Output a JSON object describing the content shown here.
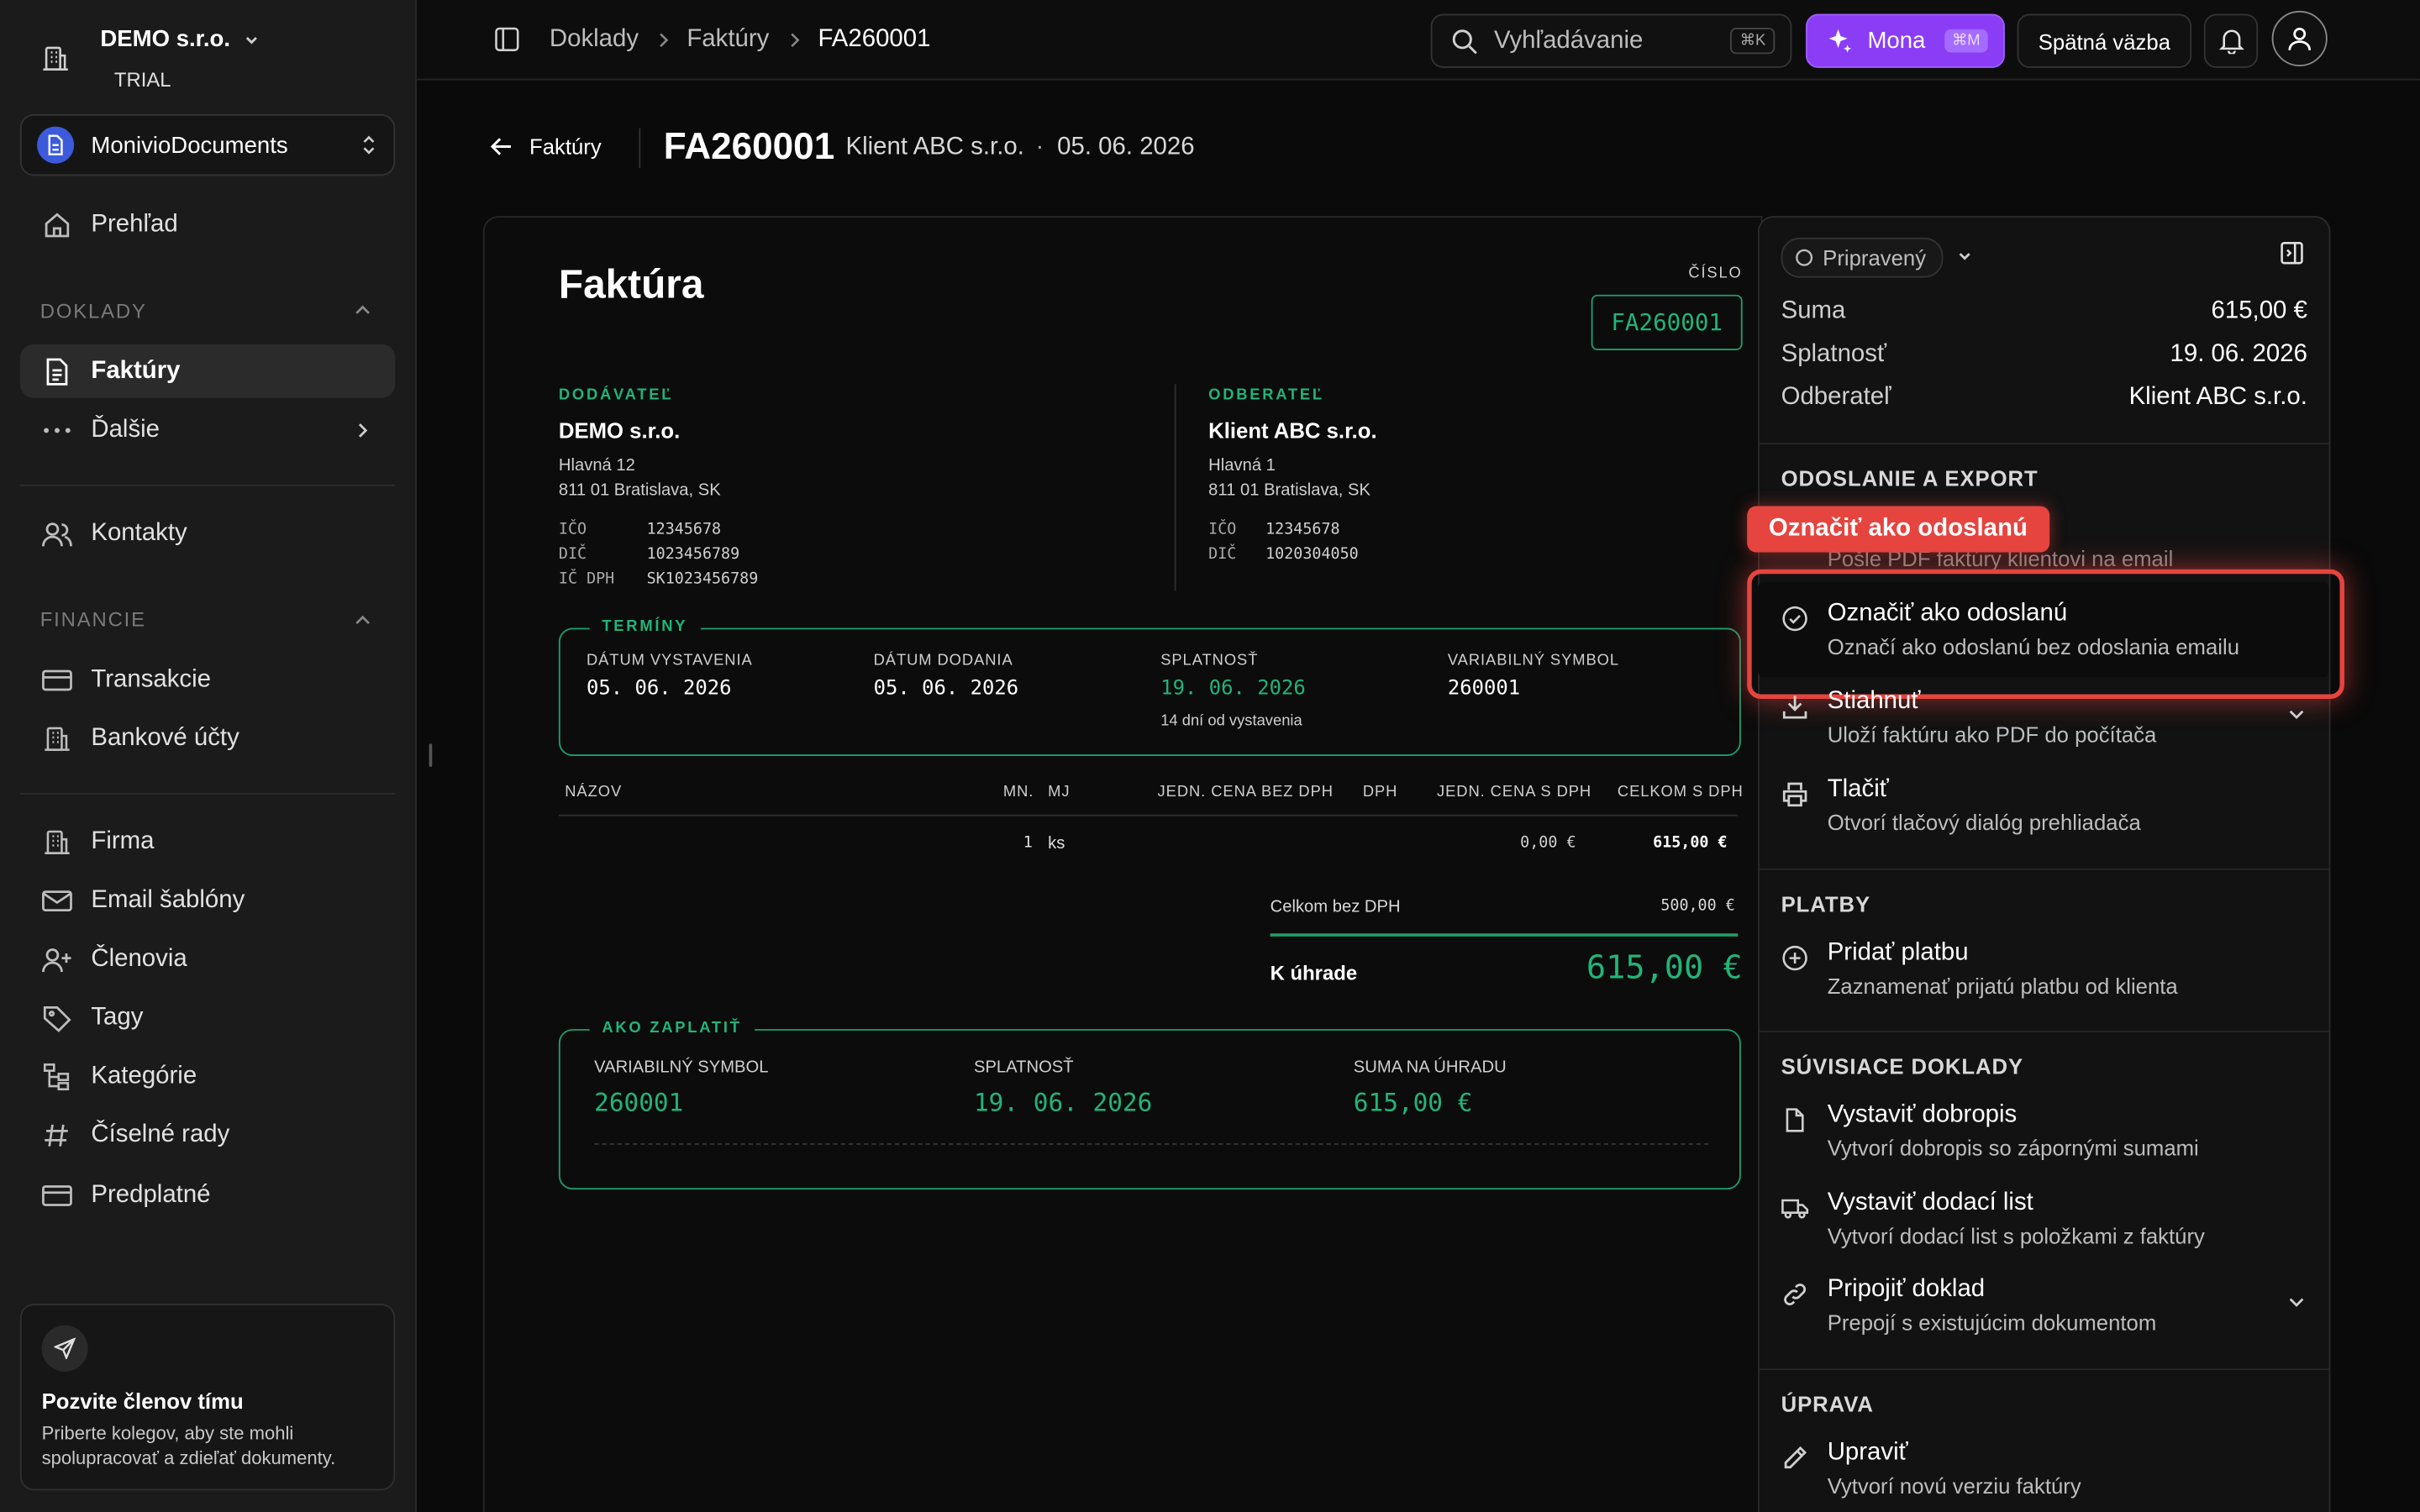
{
  "sidebar": {
    "org_name": "DEMO s.r.o.",
    "org_plan": "TRIAL",
    "workspace": "MonivioDocuments",
    "overview": "Prehľad",
    "section_docs": "DOKLADY",
    "invoices": "Faktúry",
    "more": "Ďalšie",
    "contacts": "Kontakty",
    "section_finance": "FINANCIE",
    "transactions": "Transakcie",
    "bank_accounts": "Bankové účty",
    "company": "Firma",
    "email_templates": "Email šablóny",
    "members": "Členovia",
    "tags": "Tagy",
    "categories": "Kategórie",
    "number_series": "Číselné rady",
    "subscription": "Predplatné",
    "invite_title": "Pozvite členov tímu",
    "invite_text": "Priberte kolegov, aby ste mohli spolupracovať a zdieľať dokumenty."
  },
  "topbar": {
    "crumb1": "Doklady",
    "crumb2": "Faktúry",
    "crumb3": "FA260001",
    "search_placeholder": "Vyhľadávanie",
    "search_shortcut": "⌘K",
    "mona": "Mona",
    "mona_shortcut": "⌘M",
    "feedback": "Spätná väzba"
  },
  "header": {
    "back": "Faktúry",
    "number": "FA260001",
    "client": "Klient ABC s.r.o.",
    "dot": "·",
    "date": "05. 06. 2026"
  },
  "invoice": {
    "title": "Faktúra",
    "number_label": "ČÍSLO",
    "number": "FA260001",
    "supplier_label": "DODÁVATEĽ",
    "supplier_name": "DEMO s.r.o.",
    "supplier_addr1": "Hlavná 12",
    "supplier_addr2": "811 01 Bratislava, SK",
    "supplier_ico_k": "IČO",
    "supplier_ico_v": "12345678",
    "supplier_dic_k": "DIČ",
    "supplier_dic_v": "1023456789",
    "supplier_icdph_k": "IČ DPH",
    "supplier_icdph_v": "SK1023456789",
    "customer_label": "ODBERATEĽ",
    "customer_name": "Klient ABC s.r.o.",
    "customer_addr1": "Hlavná 1",
    "customer_addr2": "811 01 Bratislava, SK",
    "customer_ico_k": "IČO",
    "customer_ico_v": "12345678",
    "customer_dic_k": "DIČ",
    "customer_dic_v": "1020304050",
    "terms_label": "TERMÍNY",
    "issue_label": "DÁTUM VYSTAVENIA",
    "issue_date": "05. 06. 2026",
    "delivery_label": "DÁTUM DODANIA",
    "delivery_date": "05. 06. 2026",
    "due_label": "SPLATNOSŤ",
    "due_date": "19. 06. 2026",
    "due_note": "14 dní od vystavenia",
    "vs_label": "VARIABILNÝ SYMBOL",
    "vs": "260001",
    "col_name": "NÁZOV",
    "col_qty": "MN.",
    "col_unit": "MJ",
    "col_price": "JEDN. CENA BEZ DPH",
    "col_vat": "DPH",
    "col_price_vat": "JEDN. CENA S DPH",
    "col_total": "CELKOM S DPH",
    "row_qty": "1",
    "row_unit": "ks",
    "row_price_vat": "0,00 €",
    "row_total": "615,00 €",
    "subtotal_label": "Celkom bez DPH",
    "subtotal": "500,00 €",
    "to_pay_label": "K úhrade",
    "to_pay": "615,00 €",
    "pay_label": "AKO ZAPLATIŤ",
    "pay_vs_label": "VARIABILNÝ SYMBOL",
    "pay_vs": "260001",
    "pay_due_label": "SPLATNOSŤ",
    "pay_due": "19. 06. 2026",
    "pay_amount_label": "SUMA NA ÚHRADU",
    "pay_amount": "615,00 €"
  },
  "panel": {
    "status": "Pripravený",
    "sum_k": "Suma",
    "sum_v": "615,00 €",
    "due_k": "Splatnosť",
    "due_v": "19. 06. 2026",
    "cust_k": "Odberateľ",
    "cust_v": "Klient ABC s.r.o.",
    "sec_send": "ODOSLANIE A EXPORT",
    "send_sub": "Pošle PDF faktúry klientovi na email",
    "tooltip": "Označiť ako odoslanú",
    "mark_title": "Označiť ako odoslanú",
    "mark_sub": "Označí ako odoslanú bez odoslania emailu",
    "download_title": "Stiahnuť",
    "download_sub": "Uloží faktúru ako PDF do počítača",
    "print_title": "Tlačiť",
    "print_sub": "Otvorí tlačový dialóg prehliadača",
    "sec_payments": "PLATBY",
    "addpay_title": "Pridať platbu",
    "addpay_sub": "Zaznamenať prijatú platbu od klienta",
    "sec_related": "SÚVISIACE DOKLADY",
    "credit_title": "Vystaviť dobropis",
    "credit_sub": "Vytvorí dobropis so zápornými sumami",
    "delivery_title": "Vystaviť dodací list",
    "delivery_sub": "Vytvorí dodací list s položkami z faktúry",
    "attach_title": "Pripojiť doklad",
    "attach_sub": "Prepojí s existujúcim dokumentom",
    "sec_edit": "ÚPRAVA",
    "edit_title": "Upraviť",
    "edit_sub": "Vytvorí novú verziu faktúry"
  },
  "colors": {
    "accent_green": "#22b47a",
    "highlight_red": "#e5443f",
    "mona_purple": "#8b3df5"
  }
}
